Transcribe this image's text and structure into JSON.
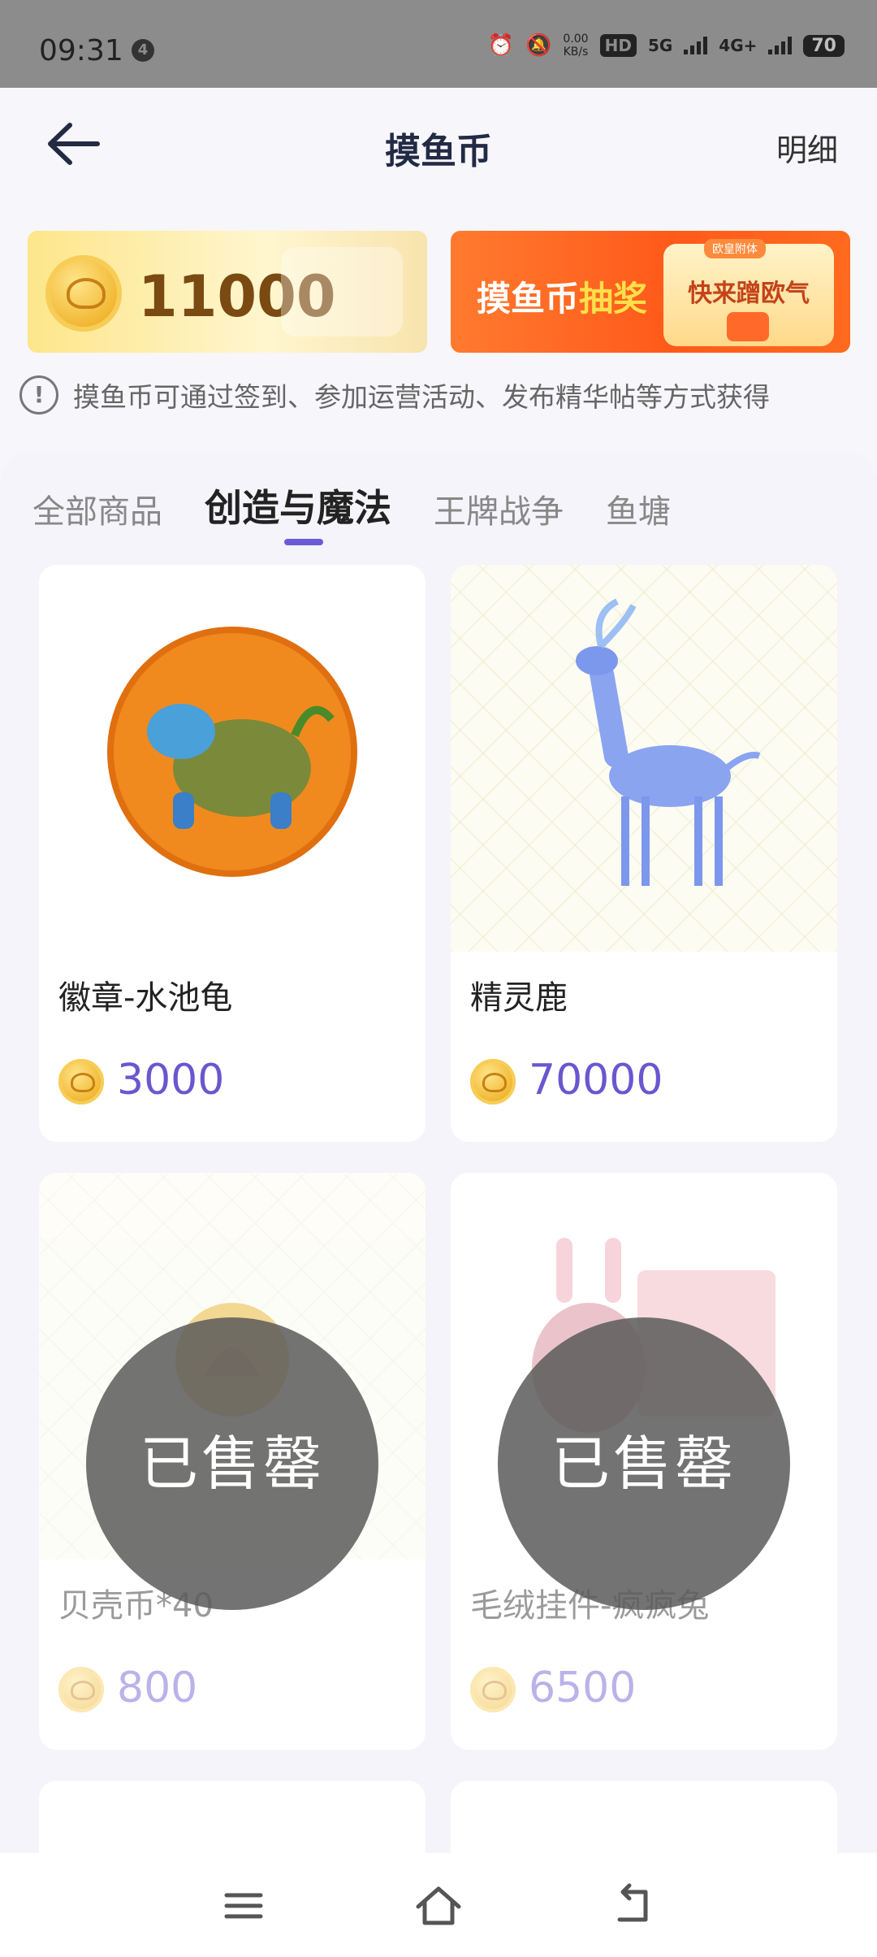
{
  "status_bar": {
    "time": "09:31",
    "notification_count": "4",
    "speed_value": "0.00",
    "speed_unit": "KB/s",
    "hd_label": "HD",
    "net1": "5G",
    "net2": "4G+",
    "battery": "70"
  },
  "header": {
    "title": "摸鱼币",
    "detail_label": "明细"
  },
  "balance": {
    "amount": "11000"
  },
  "lottery_banner": {
    "title_part1": "摸鱼币",
    "title_part2": "抽奖",
    "button_text": "快来蹭欧气",
    "tag": "欧皇附体"
  },
  "info_text": "摸鱼币可通过签到、参加运营活动、发布精华帖等方式获得",
  "tabs": [
    {
      "label": "全部商品",
      "active": false
    },
    {
      "label": "创造与魔法",
      "active": true
    },
    {
      "label": "王牌战争",
      "active": false
    },
    {
      "label": "鱼塘",
      "active": false
    }
  ],
  "products": [
    {
      "name": "徽章-水池龟",
      "price": "3000",
      "sold_out": false
    },
    {
      "name": "精灵鹿",
      "price": "70000",
      "sold_out": false
    },
    {
      "name": "贝壳币*40",
      "price": "800",
      "sold_out": true
    },
    {
      "name": "毛绒挂件-疯疯兔",
      "price": "6500",
      "sold_out": true
    }
  ],
  "sold_out_label": "已售罄",
  "colors": {
    "accent": "#6a5cd8",
    "price": "#6a56cf",
    "lottery_orange": "#ff5a1a",
    "coin_gold": "#f0b42c"
  }
}
